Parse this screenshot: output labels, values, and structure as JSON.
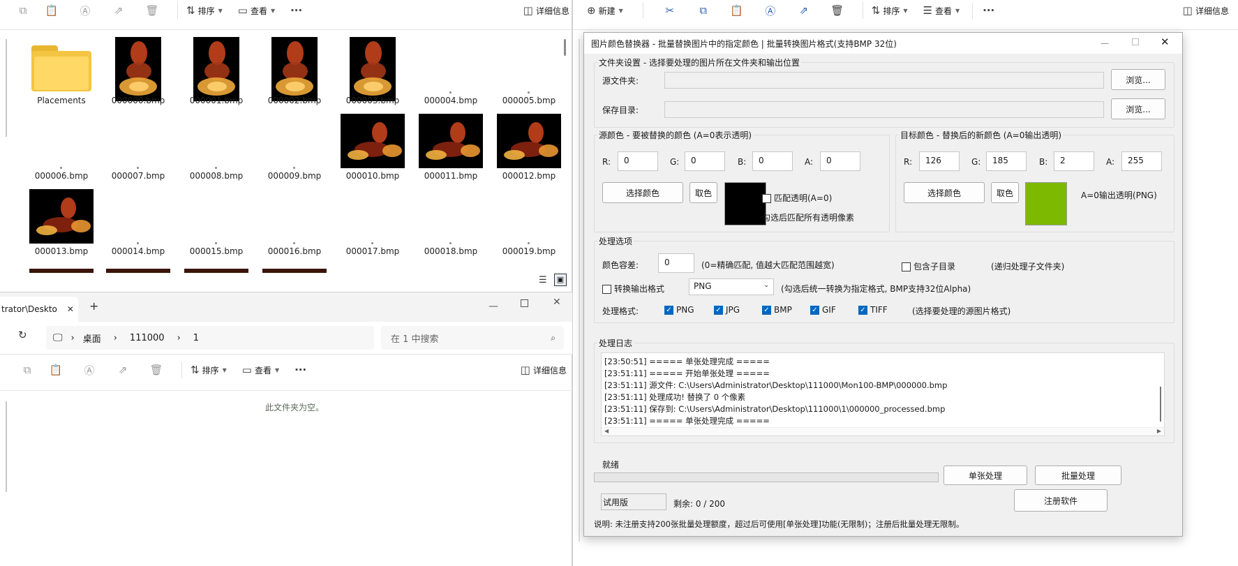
{
  "left_window_top": {
    "toolbar": {
      "sort": "排序",
      "view": "查看",
      "more": "···",
      "details": "详细信息"
    },
    "files": [
      {
        "name": "Placements",
        "kind": "folder"
      },
      {
        "name": "000000.bmp",
        "kind": "thumb"
      },
      {
        "name": "000001.bmp",
        "kind": "thumb"
      },
      {
        "name": "000002.bmp",
        "kind": "thumb"
      },
      {
        "name": "000003.bmp",
        "kind": "thumb"
      },
      {
        "name": "000004.bmp",
        "kind": "blank"
      },
      {
        "name": "000005.bmp",
        "kind": "blank"
      },
      {
        "name": "000006.bmp",
        "kind": "blank"
      },
      {
        "name": "000007.bmp",
        "kind": "blank"
      },
      {
        "name": "000008.bmp",
        "kind": "blank"
      },
      {
        "name": "000009.bmp",
        "kind": "blank"
      },
      {
        "name": "000010.bmp",
        "kind": "thumb-wide"
      },
      {
        "name": "000011.bmp",
        "kind": "thumb-wide"
      },
      {
        "name": "000012.bmp",
        "kind": "thumb-wide"
      },
      {
        "name": "000013.bmp",
        "kind": "thumb-wide"
      },
      {
        "name": "000014.bmp",
        "kind": "blank"
      },
      {
        "name": "000015.bmp",
        "kind": "blank"
      },
      {
        "name": "000016.bmp",
        "kind": "blank"
      },
      {
        "name": "000017.bmp",
        "kind": "blank"
      },
      {
        "name": "000018.bmp",
        "kind": "blank"
      },
      {
        "name": "000019.bmp",
        "kind": "blank"
      }
    ]
  },
  "left_window_bottom": {
    "tab_title": "trator\\Deskto",
    "new_tab": "+",
    "breadcrumb": [
      "桌面",
      "111000",
      "1"
    ],
    "search_placeholder": "在 1 中搜索",
    "toolbar": {
      "sort": "排序",
      "view": "查看",
      "more": "···",
      "details": "详细信息"
    },
    "empty_message": "此文件夹为空。"
  },
  "right_window": {
    "toolbar": {
      "new": "新建",
      "sort": "排序",
      "view": "查看",
      "more": "···",
      "details": "详细信息"
    }
  },
  "dialog": {
    "title": "图片颜色替换器 - 批量替换图片中的指定颜色 | 批量转换图片格式(支持BMP 32位)",
    "folder_group": {
      "title": "文件夹设置 - 选择要处理的图片所在文件夹和输出位置",
      "source_label": "源文件夹:",
      "output_label": "保存目录:",
      "browse": "浏览..."
    },
    "source_color": {
      "title": "源颜色 - 要被替换的颜色 (A=0表示透明)",
      "r_label": "R:",
      "g_label": "G:",
      "b_label": "B:",
      "a_label": "A:",
      "r": "0",
      "g": "0",
      "b": "0",
      "a": "0",
      "pick": "选择颜色",
      "eyedrop": "取色",
      "swatch": "#000000",
      "match_transparent": "匹配透明(A=0)",
      "match_hint": "勾选后匹配所有透明像素"
    },
    "target_color": {
      "title": "目标颜色 - 替换后的新颜色 (A=0输出透明)",
      "r_label": "R:",
      "g_label": "G:",
      "b_label": "B:",
      "a_label": "A:",
      "r": "126",
      "g": "185",
      "b": "2",
      "a": "255",
      "pick": "选择颜色",
      "eyedrop": "取色",
      "swatch": "#7eb902",
      "hint": "A=0输出透明(PNG)"
    },
    "options": {
      "title": "处理选项",
      "tolerance_label": "颜色容差:",
      "tolerance": "0",
      "tolerance_hint": "(0=精确匹配, 值越大匹配范围越宽)",
      "subdirs": "包含子目录",
      "subdirs_hint": "(递归处理子文件夹)",
      "convert_label": "转换输出格式",
      "format_selected": "PNG",
      "convert_hint": "(勾选后统一转换为指定格式, BMP支持32位Alpha)",
      "formats_label": "处理格式:",
      "formats": [
        "PNG",
        "JPG",
        "BMP",
        "GIF",
        "TIFF"
      ],
      "formats_hint": "(选择要处理的源图片格式)"
    },
    "log": {
      "title": "处理日志",
      "lines": [
        "[23:50:51] ===== 单张处理完成 =====",
        "[23:51:11] ===== 开始单张处理 =====",
        "[23:51:11] 源文件: C:\\Users\\Administrator\\Desktop\\111000\\Mon100-BMP\\000000.bmp",
        "[23:51:11] 处理成功! 替换了 0 个像素",
        "[23:51:11] 保存到: C:\\Users\\Administrator\\Desktop\\111000\\1\\000000_processed.bmp",
        "[23:51:11] ===== 单张处理完成 ====="
      ]
    },
    "status": "就绪",
    "progress": 0,
    "single_btn": "单张处理",
    "batch_btn": "批量处理",
    "edition": "试用版",
    "remaining": "剩余: 0 / 200",
    "register_btn": "注册软件",
    "note": "说明: 未注册支持200张批量处理额度，超过后可使用[单张处理]功能(无限制)；注册后批量处理无限制。"
  }
}
